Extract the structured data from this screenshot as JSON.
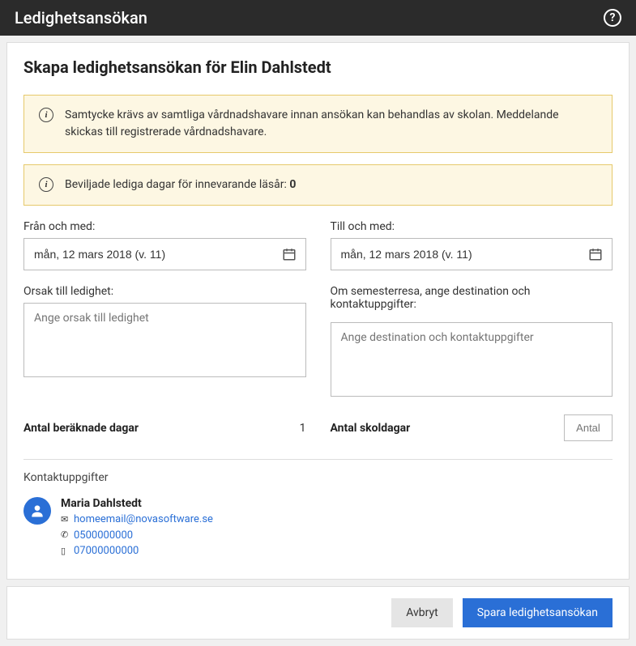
{
  "header": {
    "title": "Ledighetsansökan",
    "help_tooltip": "?"
  },
  "page_title": "Skapa ledighetsansökan för Elin Dahlstedt",
  "alerts": {
    "consent": "Samtycke krävs av samtliga vårdnadshavare innan ansökan kan behandlas av skolan. Meddelande skickas till registrerade vårdnadshavare.",
    "granted_prefix": "Beviljade lediga dagar för innevarande läsår: ",
    "granted_value": "0"
  },
  "labels": {
    "from": "Från och med:",
    "to": "Till och med:",
    "reason": "Orsak till ledighet:",
    "destination": "Om semesterresa, ange destination och kontaktuppgifter:",
    "calc_days": "Antal beräknade dagar",
    "school_days": "Antal skoldagar",
    "contacts": "Kontaktuppgifter"
  },
  "placeholders": {
    "reason": "Ange orsak till ledighet",
    "destination": "Ange destination och kontaktuppgifter",
    "school_days": "Antal"
  },
  "values": {
    "from_date": "mån, 12 mars 2018 (v. 11)",
    "to_date": "mån, 12 mars 2018 (v. 11)",
    "reason": "",
    "destination": "",
    "calc_days": "1",
    "school_days": ""
  },
  "contact": {
    "name": "Maria Dahlstedt",
    "email": "homeemail@novasoftware.se",
    "phone": "0500000000",
    "mobile": "07000000000"
  },
  "buttons": {
    "cancel": "Avbryt",
    "save": "Spara ledighetsansökan"
  }
}
